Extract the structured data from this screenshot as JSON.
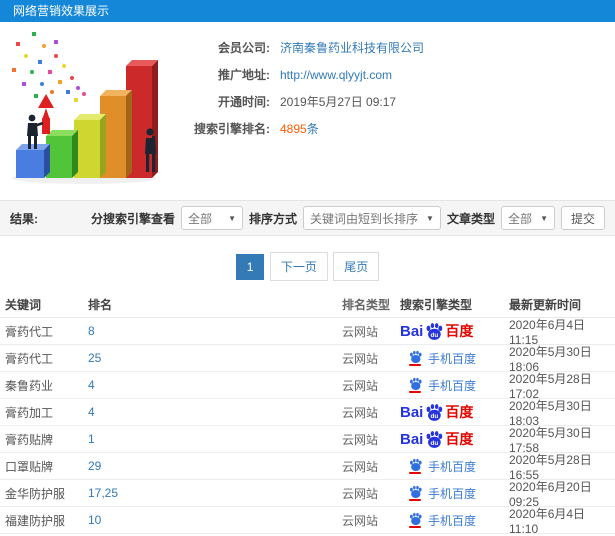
{
  "header": {
    "title": "网络营销效果展示"
  },
  "info": {
    "company_label": "会员公司:",
    "company_value": "济南秦鲁药业科技有限公司",
    "url_label": "推广地址:",
    "url_value": "http://www.qlyyjt.com",
    "open_time_label": "开通时间:",
    "open_time_value": "2019年5月27日 09:17",
    "rank_label": "搜索引擎排名:",
    "rank_count": "4895",
    "rank_unit": "条"
  },
  "filters": {
    "result_label": "结果:",
    "engine_label": "分搜索引擎查看",
    "engine_value": "全部",
    "sort_label": "排序方式",
    "sort_value": "关键词由短到长排序",
    "article_label": "文章类型",
    "article_value": "全部",
    "submit_label": "提交",
    "caret": "▼"
  },
  "pagination": {
    "current": "1",
    "next_label": "下一页",
    "last_label": "尾页"
  },
  "table": {
    "headers": {
      "keyword": "关键词",
      "rank": "排名",
      "rank_type": "排名类型",
      "engine_type": "搜索引擎类型",
      "updated": "最新更新时间"
    },
    "engine_labels": {
      "baidu_bai": "Bai",
      "baidu_du": "du",
      "baidu_cn": "百度",
      "mobile": "手机百度"
    },
    "rows": [
      {
        "keyword": "膏药代工",
        "rank": "8",
        "rank_type": "云网站",
        "engine": "baidu",
        "updated": "2020年6月4日 11:15"
      },
      {
        "keyword": "膏药代工",
        "rank": "25",
        "rank_type": "云网站",
        "engine": "mobile-baidu",
        "updated": "2020年5月30日 18:06"
      },
      {
        "keyword": "秦鲁药业",
        "rank": "4",
        "rank_type": "云网站",
        "engine": "mobile-baidu",
        "updated": "2020年5月28日 17:02"
      },
      {
        "keyword": "膏药加工",
        "rank": "4",
        "rank_type": "云网站",
        "engine": "baidu",
        "updated": "2020年5月30日 18:03"
      },
      {
        "keyword": "膏药贴牌",
        "rank": "1",
        "rank_type": "云网站",
        "engine": "baidu",
        "updated": "2020年5月30日 17:58"
      },
      {
        "keyword": "口罩贴牌",
        "rank": "29",
        "rank_type": "云网站",
        "engine": "mobile-baidu",
        "updated": "2020年5月28日 16:55"
      },
      {
        "keyword": "金华防护服",
        "rank": "17,25",
        "rank_type": "云网站",
        "engine": "mobile-baidu",
        "updated": "2020年6月20日 09:25"
      },
      {
        "keyword": "福建防护服",
        "rank": "10",
        "rank_type": "云网站",
        "engine": "mobile-baidu",
        "updated": "2020年6月4日 11:10"
      }
    ]
  },
  "colors": {
    "topbar_blue": "#1487d8",
    "link_blue": "#337ab7",
    "highlight_orange": "#ff5a00",
    "baidu_blue": "#2534dd",
    "baidu_red": "#e10601",
    "filter_bg": "#f5f5f5"
  },
  "icons": {
    "dropdown_arrow": "▼",
    "baidu_paw": "baidu-paw-icon",
    "hero": "3d-bar-chart-illustration"
  }
}
